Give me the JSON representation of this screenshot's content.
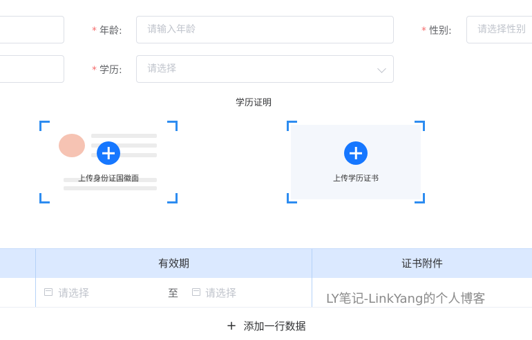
{
  "form": {
    "age_label": "年龄:",
    "age_placeholder": "请输入年龄",
    "gender_label": "性别:",
    "gender_placeholder": "请选择性别",
    "education_label": "学历:",
    "education_placeholder": "请选择",
    "required_mark": "*"
  },
  "upload_section": {
    "title": "学历证明",
    "id_card_label": "上传身份证国徽面",
    "certificate_label": "上传学历证书"
  },
  "table": {
    "columns": [
      "有效期",
      "证书附件"
    ],
    "row": {
      "start_placeholder": "请选择",
      "separator": "至",
      "end_placeholder": "请选择",
      "attachment_text": "LY笔记-LinkYang的个人博客"
    },
    "add_row_icon": "+",
    "add_row_label": "添加一行数据"
  },
  "colors": {
    "accent": "#1677ff",
    "corner": "#2d8cf0",
    "header_bg": "#dbe9ff",
    "required": "#f56c6c"
  },
  "icons": [
    "plus-circle-icon",
    "chevron-down-icon",
    "calendar-icon",
    "plus-icon"
  ]
}
